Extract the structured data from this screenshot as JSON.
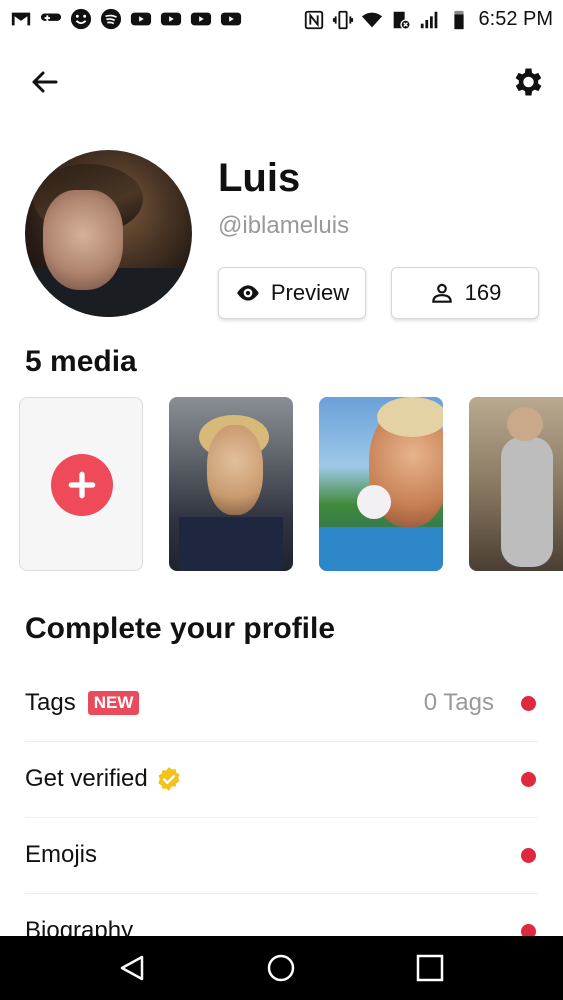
{
  "status_bar": {
    "time": "6:52 PM",
    "icons": [
      "gmail-icon",
      "game-controller-icon",
      "smiley-icon",
      "spotify-icon",
      "youtube-icon",
      "youtube-icon",
      "youtube-icon",
      "youtube-icon",
      "nfc-icon",
      "vibrate-icon",
      "wifi-icon",
      "alarm-icon",
      "signal-icon",
      "battery-icon"
    ]
  },
  "header": {
    "back_icon": "back-arrow-icon",
    "settings_icon": "gear-icon"
  },
  "profile": {
    "name": "Luis",
    "handle": "@iblameluis",
    "preview_label": "Preview",
    "followers_count": "169"
  },
  "media": {
    "title": "5 media"
  },
  "complete_profile": {
    "title": "Complete your profile",
    "items": [
      {
        "label": "Tags",
        "badge": "NEW",
        "value": "0 Tags"
      },
      {
        "label": "Get verified"
      },
      {
        "label": "Emojis"
      },
      {
        "label": "Biography"
      }
    ]
  },
  "colors": {
    "accent": "#e0283f",
    "add_button": "#ee4a5a",
    "verified": "#f4c21c"
  }
}
